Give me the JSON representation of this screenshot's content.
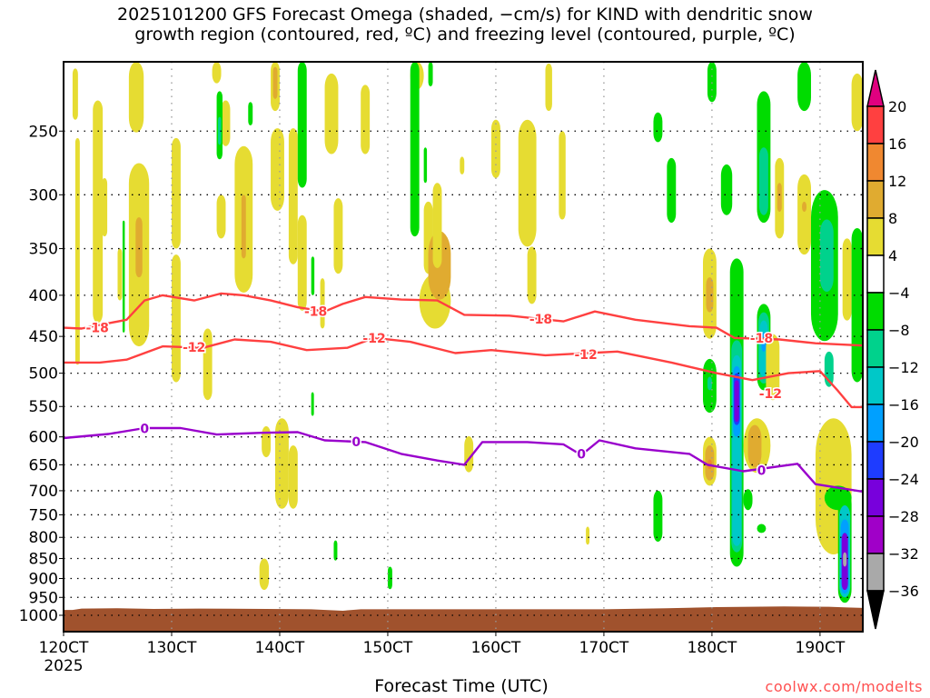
{
  "chart_data": {
    "type": "heatmap",
    "title_line1": "2025101200 GFS Forecast Omega (shaded, −cm/s) for KIND with dendritic snow",
    "title_line2": "growth region (contoured, red, ºC) and freezing level (contoured, purple, ºC)",
    "xlabel": "Forecast Time (UTC)",
    "ylabel": "",
    "watermark": "coolwx.com/modelts",
    "x_units": "hours since 2025-10-12 00Z",
    "xlim": [
      0,
      177.5
    ],
    "ylim_hPa": [
      205,
      1048
    ],
    "y_scale": "log",
    "grid": "dotted",
    "x_ticks": [
      {
        "hour": 0,
        "label": "120CT",
        "sub": "2025"
      },
      {
        "hour": 24,
        "label": "130CT"
      },
      {
        "hour": 48,
        "label": "140CT"
      },
      {
        "hour": 72,
        "label": "150CT"
      },
      {
        "hour": 96,
        "label": "160CT"
      },
      {
        "hour": 120,
        "label": "170CT"
      },
      {
        "hour": 144,
        "label": "180CT"
      },
      {
        "hour": 168,
        "label": "190CT"
      }
    ],
    "y_ticks": [
      "250",
      "300",
      "350",
      "400",
      "450",
      "500",
      "550",
      "600",
      "650",
      "700",
      "750",
      "800",
      "850",
      "900",
      "950",
      "1000"
    ],
    "colorbar": {
      "labels": [
        "20",
        "16",
        "12",
        "8",
        "4",
        "−4",
        "−8",
        "−12",
        "−16",
        "−20",
        "−24",
        "−28",
        "−32",
        "−36"
      ],
      "over_color": "#e0007f",
      "under_color": "#000000",
      "bands": [
        {
          "min": 16,
          "max": 20,
          "color": "#ff4040"
        },
        {
          "min": 12,
          "max": 16,
          "color": "#f08830"
        },
        {
          "min": 8,
          "max": 12,
          "color": "#e0ab30"
        },
        {
          "min": 4,
          "max": 8,
          "color": "#e6dc32"
        },
        {
          "min": -4,
          "max": 4,
          "color": "#ffffff"
        },
        {
          "min": -8,
          "max": -4,
          "color": "#00dc00"
        },
        {
          "min": -12,
          "max": -8,
          "color": "#00d28c"
        },
        {
          "min": -16,
          "max": -12,
          "color": "#00c8c8"
        },
        {
          "min": -20,
          "max": -16,
          "color": "#00a0ff"
        },
        {
          "min": -24,
          "max": -20,
          "color": "#1e3cff"
        },
        {
          "min": -28,
          "max": -24,
          "color": "#7800dc"
        },
        {
          "min": -32,
          "max": -28,
          "color": "#a000c8"
        },
        {
          "min": -36,
          "max": -32,
          "color": "#a9a9a9"
        }
      ]
    },
    "terrain_color": "#a0522d",
    "surface_pressure": [
      [
        0,
        985
      ],
      [
        2,
        985
      ],
      [
        4,
        981
      ],
      [
        12,
        980
      ],
      [
        20,
        982
      ],
      [
        30,
        981
      ],
      [
        45,
        982
      ],
      [
        55,
        983
      ],
      [
        62,
        987
      ],
      [
        66,
        983
      ],
      [
        80,
        983
      ],
      [
        100,
        983
      ],
      [
        120,
        983
      ],
      [
        134,
        980
      ],
      [
        145,
        977
      ],
      [
        160,
        975
      ],
      [
        170,
        976
      ],
      [
        174,
        978
      ],
      [
        177.5,
        979
      ]
    ],
    "omega_cells": [
      [
        2,
        3.2,
        209,
        242,
        6
      ],
      [
        2.6,
        3.6,
        255,
        488,
        6
      ],
      [
        6.5,
        8.7,
        229,
        433,
        6
      ],
      [
        8.5,
        9.7,
        286,
        338,
        6
      ],
      [
        12,
        13,
        350,
        406,
        6
      ],
      [
        14.5,
        17.8,
        205,
        251,
        6
      ],
      [
        14.5,
        19,
        274,
        463,
        6
      ],
      [
        16,
        17.5,
        320,
        380,
        10
      ],
      [
        24,
        26,
        255,
        350,
        6
      ],
      [
        24,
        26,
        356,
        513,
        6
      ],
      [
        33,
        35,
        205,
        218,
        6
      ],
      [
        35,
        37,
        229,
        261,
        6
      ],
      [
        34,
        36,
        300,
        340,
        6
      ],
      [
        38,
        42,
        261,
        397,
        6
      ],
      [
        39.5,
        40.5,
        300,
        360,
        10
      ],
      [
        46,
        48,
        205,
        236,
        6
      ],
      [
        46.5,
        47.5,
        208,
        228,
        10
      ],
      [
        46,
        49,
        248,
        314,
        6
      ],
      [
        50,
        52,
        248,
        366,
        6
      ],
      [
        52,
        54,
        318,
        418,
        6
      ],
      [
        58,
        61,
        212,
        267,
        6
      ],
      [
        60,
        62,
        303,
        376,
        6
      ],
      [
        57,
        58,
        381,
        440,
        6
      ],
      [
        47,
        50,
        569,
        737,
        6
      ],
      [
        44,
        46,
        582,
        636,
        6
      ],
      [
        50,
        52,
        615,
        737,
        6
      ],
      [
        31,
        33,
        440,
        540,
        6
      ],
      [
        66,
        68,
        219,
        267,
        6
      ],
      [
        77,
        80,
        205,
        222,
        6
      ],
      [
        80,
        82,
        306,
        376,
        6
      ],
      [
        79,
        86,
        376,
        440,
        6
      ],
      [
        81,
        86,
        333,
        405,
        10
      ],
      [
        82,
        84,
        290,
        370,
        6
      ],
      [
        88,
        89,
        269,
        283,
        6
      ],
      [
        95,
        97,
        242,
        286,
        6
      ],
      [
        101,
        105,
        242,
        348,
        6
      ],
      [
        103,
        105,
        348,
        410,
        6
      ],
      [
        107,
        108.5,
        206,
        236,
        6
      ],
      [
        110,
        111.5,
        250,
        322,
        6
      ],
      [
        89,
        91,
        599,
        664,
        6
      ],
      [
        43.5,
        45.6,
        850,
        930,
        6
      ],
      [
        116,
        116.8,
        776,
        817,
        6
      ],
      [
        77,
        79,
        205,
        338,
        -6
      ],
      [
        81,
        82,
        205,
        220,
        -6
      ],
      [
        34,
        35.3,
        223,
        271,
        -6
      ],
      [
        34.3,
        35,
        240,
        260,
        -10
      ],
      [
        41,
        42,
        230,
        246,
        -6
      ],
      [
        52,
        54,
        205,
        294,
        -6
      ],
      [
        13.1,
        13.6,
        323,
        445,
        -6
      ],
      [
        55,
        55.7,
        358,
        400,
        -6
      ],
      [
        60,
        60.8,
        807,
        855,
        -6
      ],
      [
        72,
        73,
        870,
        928,
        -6
      ],
      [
        55,
        55.6,
        528,
        565,
        -6
      ],
      [
        80,
        80.7,
        262,
        290,
        -6
      ],
      [
        131,
        133,
        237,
        258,
        -6
      ],
      [
        134,
        136,
        270,
        325,
        -6
      ],
      [
        143,
        145,
        205,
        230,
        -6
      ],
      [
        146,
        148.5,
        275,
        318,
        -6
      ],
      [
        154,
        157,
        223,
        325,
        -6
      ],
      [
        154.5,
        156.5,
        262,
        318,
        -10
      ],
      [
        158,
        160,
        270,
        340,
        6
      ],
      [
        158.5,
        159.5,
        290,
        315,
        10
      ],
      [
        163,
        166,
        205,
        236,
        -6
      ],
      [
        163,
        166,
        283,
        356,
        6
      ],
      [
        164,
        165,
        306,
        315,
        10
      ],
      [
        175,
        177.5,
        212,
        250,
        6
      ],
      [
        166,
        172,
        296,
        456,
        -6
      ],
      [
        168,
        171,
        322,
        396,
        -10
      ],
      [
        169,
        171,
        470,
        520,
        -10
      ],
      [
        173,
        175,
        340,
        430,
        6
      ],
      [
        175,
        177.5,
        330,
        513,
        -6
      ],
      [
        142,
        145,
        350,
        453,
        6
      ],
      [
        142.7,
        144.3,
        380,
        420,
        10
      ],
      [
        148,
        151,
        360,
        870,
        -6
      ],
      [
        148.3,
        150.7,
        455,
        835,
        -10
      ],
      [
        148.5,
        150.5,
        475,
        820,
        -14
      ],
      [
        148.7,
        150.3,
        490,
        600,
        -18
      ],
      [
        148.8,
        150.2,
        500,
        580,
        -22
      ],
      [
        149,
        150,
        510,
        575,
        -26
      ],
      [
        154,
        157,
        410,
        525,
        -6
      ],
      [
        154.3,
        156.7,
        420,
        515,
        -10
      ],
      [
        154.6,
        156.4,
        430,
        505,
        -14
      ],
      [
        155,
        156,
        445,
        470,
        -18
      ],
      [
        142,
        145,
        480,
        560,
        -6
      ],
      [
        143,
        144,
        505,
        525,
        -10
      ],
      [
        156,
        159,
        447,
        540,
        6
      ],
      [
        142,
        145,
        600,
        690,
        6
      ],
      [
        142.5,
        144.5,
        615,
        680,
        10
      ],
      [
        143,
        144,
        640,
        658,
        14
      ],
      [
        151,
        157,
        569,
        665,
        6
      ],
      [
        152,
        155,
        580,
        655,
        10
      ],
      [
        151,
        153,
        697,
        740,
        -6
      ],
      [
        154,
        156,
        770,
        790,
        -6
      ],
      [
        131,
        133,
        700,
        810,
        -6
      ],
      [
        167,
        175,
        569,
        840,
        6
      ],
      [
        169,
        175,
        690,
        740,
        -6
      ],
      [
        172,
        175,
        700,
        965,
        -6
      ],
      [
        172.3,
        174.7,
        730,
        950,
        -14
      ],
      [
        172.6,
        174.4,
        760,
        940,
        -18
      ],
      [
        172.8,
        174.2,
        790,
        930,
        -26
      ],
      [
        173.1,
        173.9,
        835,
        870,
        -34
      ]
    ],
    "contours": [
      {
        "name": "dgz-minus18",
        "level": "-18",
        "color": "#ff4040",
        "points": [
          [
            0,
            439
          ],
          [
            4,
            440
          ],
          [
            14,
            429
          ],
          [
            18,
            406
          ],
          [
            22,
            400
          ],
          [
            29,
            406
          ],
          [
            35,
            398
          ],
          [
            40,
            400
          ],
          [
            46,
            406
          ],
          [
            52,
            414
          ],
          [
            58,
            419
          ],
          [
            62,
            410
          ],
          [
            67,
            402
          ],
          [
            75,
            405
          ],
          [
            83,
            406
          ],
          [
            89,
            423
          ],
          [
            99,
            424
          ],
          [
            111,
            431
          ],
          [
            118,
            419
          ],
          [
            127,
            429
          ],
          [
            139,
            437
          ],
          [
            145,
            439
          ],
          [
            149,
            452
          ],
          [
            159,
            454
          ],
          [
            167,
            459
          ],
          [
            177.5,
            462
          ]
        ],
        "labels": [
          [
            7.5,
            439
          ],
          [
            56,
            419
          ],
          [
            106,
            428
          ],
          [
            155,
            452
          ]
        ]
      },
      {
        "name": "dgz-minus12",
        "level": "-12",
        "color": "#ff4040",
        "points": [
          [
            0,
            485
          ],
          [
            8,
            485
          ],
          [
            14,
            481
          ],
          [
            22,
            463
          ],
          [
            31,
            465
          ],
          [
            38,
            454
          ],
          [
            46,
            457
          ],
          [
            54,
            468
          ],
          [
            63,
            465
          ],
          [
            69,
            452
          ],
          [
            77,
            457
          ],
          [
            87,
            472
          ],
          [
            95,
            468
          ],
          [
            107,
            475
          ],
          [
            123,
            470
          ],
          [
            135,
            485
          ],
          [
            145,
            500
          ],
          [
            153,
            510
          ],
          [
            161,
            500
          ],
          [
            168,
            497
          ],
          [
            172,
            526
          ],
          [
            175,
            551
          ],
          [
            177.5,
            551
          ]
        ],
        "labels": [
          [
            29,
            464
          ],
          [
            69,
            452
          ],
          [
            116,
            474
          ],
          [
            157,
            530
          ]
        ]
      },
      {
        "name": "freezing-level",
        "level": "0",
        "color": "#9900cc",
        "points": [
          [
            0,
            602
          ],
          [
            10,
            595
          ],
          [
            18,
            585
          ],
          [
            26,
            585
          ],
          [
            34,
            596
          ],
          [
            44,
            593
          ],
          [
            52,
            592
          ],
          [
            58,
            606
          ],
          [
            67,
            609
          ],
          [
            75,
            630
          ],
          [
            83,
            642
          ],
          [
            89,
            650
          ],
          [
            93,
            609
          ],
          [
            103,
            609
          ],
          [
            111,
            613
          ],
          [
            115,
            632
          ],
          [
            119,
            606
          ],
          [
            127,
            620
          ],
          [
            139,
            630
          ],
          [
            143,
            650
          ],
          [
            151,
            662
          ],
          [
            163,
            648
          ],
          [
            167,
            687
          ],
          [
            177.5,
            702
          ]
        ],
        "labels": [
          [
            18,
            586
          ],
          [
            65,
            608
          ],
          [
            115,
            630
          ],
          [
            155,
            660
          ]
        ]
      }
    ]
  }
}
